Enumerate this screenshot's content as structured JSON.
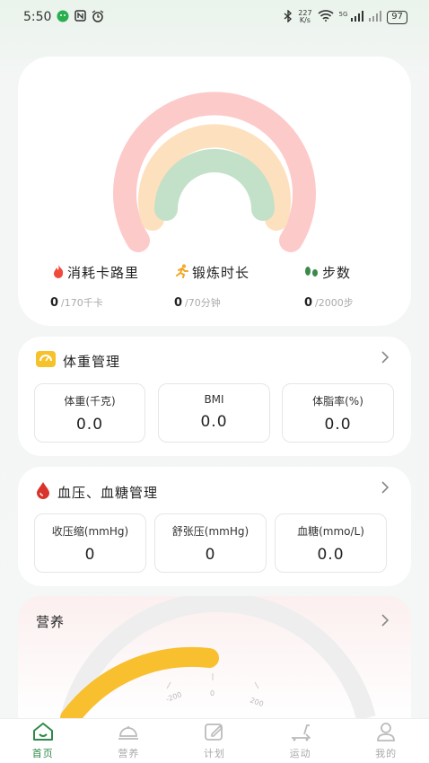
{
  "status": {
    "time": "5:50",
    "net_speed_value": "227",
    "net_speed_unit": "K/s",
    "signal": "5G",
    "battery": "97"
  },
  "activity": {
    "colors": {
      "outer": "#fdcaca",
      "middle": "#fde0bd",
      "inner": "#c3e0c9"
    },
    "calories": {
      "label": "消耗卡路里",
      "value": "0",
      "target": "/170千卡"
    },
    "exercise": {
      "label": "锻炼时长",
      "value": "0",
      "target": "/70分钟"
    },
    "steps": {
      "label": "步数",
      "value": "0",
      "target": "/2000步"
    }
  },
  "weight": {
    "title": "体重管理",
    "items": [
      {
        "label": "体重(千克)",
        "value": "0.0"
      },
      {
        "label": "BMI",
        "value": "0.0"
      },
      {
        "label": "体脂率(%)",
        "value": "0.0"
      }
    ]
  },
  "blood": {
    "title": "血压、血糖管理",
    "items": [
      {
        "label": "收压缩(mmHg)",
        "value": "0"
      },
      {
        "label": "舒张压(mmHg)",
        "value": "0"
      },
      {
        "label": "血糖(mmo/L)",
        "value": "0.0"
      }
    ]
  },
  "nutrition": {
    "title": "营养",
    "gauge_ticks": [
      "-200",
      "0",
      "200"
    ],
    "gauge_color": "#f8bf2e"
  },
  "tabs": [
    {
      "label": "首页",
      "icon": "home-icon",
      "active": true
    },
    {
      "label": "营养",
      "icon": "dish-icon",
      "active": false
    },
    {
      "label": "计划",
      "icon": "edit-icon",
      "active": false
    },
    {
      "label": "运动",
      "icon": "treadmill-icon",
      "active": false
    },
    {
      "label": "我的",
      "icon": "user-icon",
      "active": false
    }
  ]
}
